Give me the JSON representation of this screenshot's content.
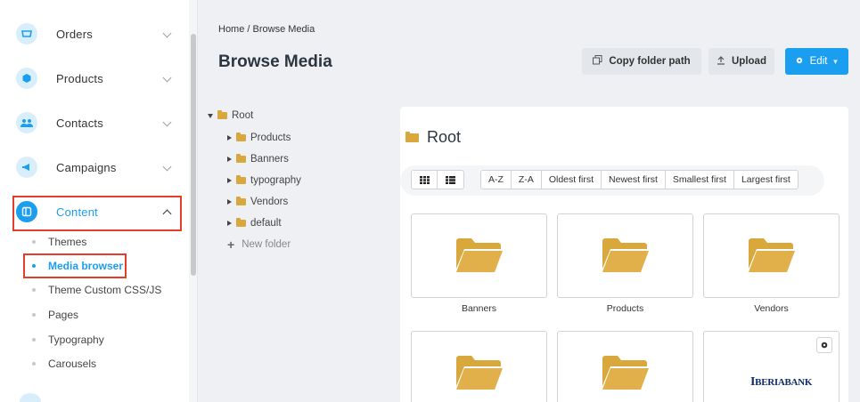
{
  "sidebar": {
    "items": [
      {
        "label": "Orders",
        "icon": "cart-icon"
      },
      {
        "label": "Products",
        "icon": "box-icon"
      },
      {
        "label": "Contacts",
        "icon": "users-icon"
      },
      {
        "label": "Campaigns",
        "icon": "megaphone-icon"
      },
      {
        "label": "Content",
        "icon": "layout-icon"
      }
    ],
    "content_subitems": [
      "Themes",
      "Media browser",
      "Theme Custom CSS/JS",
      "Pages",
      "Typography",
      "Carousels"
    ]
  },
  "header": {
    "breadcrumb": "Home / Browse Media",
    "title": "Browse Media",
    "copy_label": "Copy folder path",
    "upload_label": "Upload",
    "edit_label": "Edit"
  },
  "tree": {
    "root": "Root",
    "children": [
      "Products",
      "Banners",
      "typography",
      "Vendors",
      "default"
    ],
    "new_folder": "New folder"
  },
  "panel": {
    "title": "Root",
    "sort_options": [
      "A-Z",
      "Z-A",
      "Oldest first",
      "Newest first",
      "Smallest first",
      "Largest first"
    ],
    "tiles": [
      "Banners",
      "Products",
      "Vendors"
    ],
    "logo_text_big": "I",
    "logo_text_rest": "BERIA",
    "logo_text_end": "BANK"
  },
  "colors": {
    "accent": "#1a9ef0",
    "highlight_box": "#e53d2b",
    "folder": "#d9a83c"
  }
}
